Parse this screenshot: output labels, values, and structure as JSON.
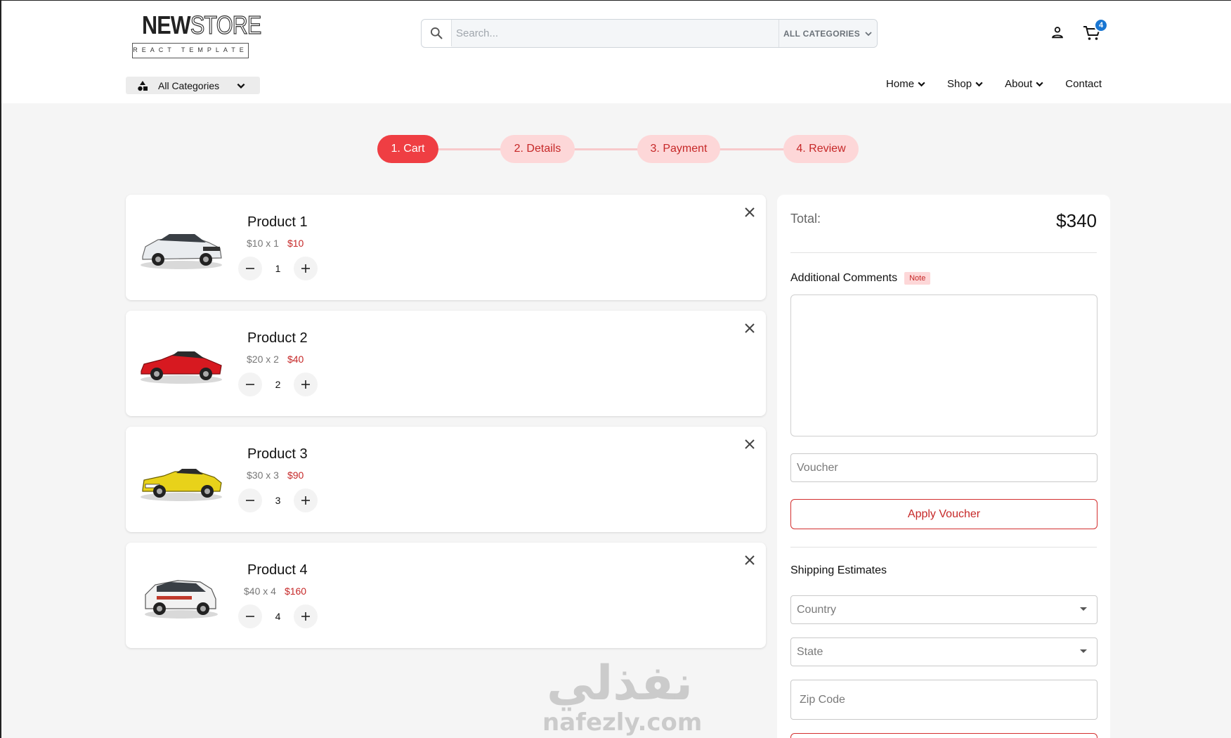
{
  "header": {
    "logo": {
      "word1": "NEW",
      "word2": "STORE",
      "tagline": "REACT TEMPLATE"
    },
    "search": {
      "placeholder": "Search...",
      "category_label": "ALL CATEGORIES"
    },
    "cart_count": "4",
    "all_categories_label": "All Categories",
    "nav": [
      {
        "label": "Home",
        "has_dropdown": true
      },
      {
        "label": "Shop",
        "has_dropdown": true
      },
      {
        "label": "About",
        "has_dropdown": true
      },
      {
        "label": "Contact",
        "has_dropdown": false
      }
    ]
  },
  "steps": [
    {
      "label": "1. Cart",
      "active": true
    },
    {
      "label": "2. Details",
      "active": false
    },
    {
      "label": "3. Payment",
      "active": false
    },
    {
      "label": "4. Review",
      "active": false
    }
  ],
  "cart_items": [
    {
      "name": "Product 1",
      "unit": "$10 x 1",
      "total": "$10",
      "qty": "1",
      "car_color": "#e9ecef"
    },
    {
      "name": "Product 2",
      "unit": "$20 x 2",
      "total": "$40",
      "qty": "2",
      "car_color": "#d71920"
    },
    {
      "name": "Product 3",
      "unit": "$30 x 3",
      "total": "$90",
      "qty": "3",
      "car_color": "#e8d21a"
    },
    {
      "name": "Product 4",
      "unit": "$40 x 4",
      "total": "$160",
      "qty": "4",
      "car_color": "#f2f2f2"
    }
  ],
  "summary": {
    "total_label": "Total:",
    "total_value": "$340",
    "comments_label": "Additional Comments",
    "note_badge": "Note",
    "voucher_placeholder": "Voucher",
    "apply_label": "Apply Voucher",
    "shipping_label": "Shipping Estimates",
    "country_label": "Country",
    "state_label": "State",
    "zip_placeholder": "Zip Code"
  },
  "watermark": {
    "arabic": "نفذلي",
    "latin": "nafezly.com"
  },
  "colors": {
    "accent": "#ef3e43",
    "accent_light": "#fdd7d8",
    "price_red": "#c62828",
    "badge_blue": "#1976d2"
  }
}
